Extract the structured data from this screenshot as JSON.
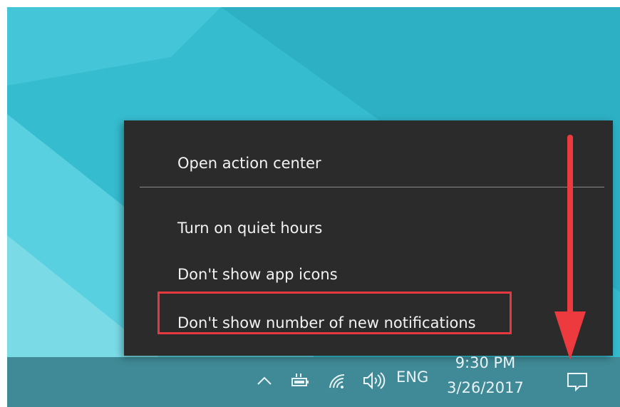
{
  "context_menu": {
    "items": [
      {
        "label": "Open action center"
      },
      {
        "label": "Turn on quiet hours"
      },
      {
        "label": "Don't show app icons"
      },
      {
        "label": "Don't show number of new notifications"
      }
    ],
    "highlighted_item_index": 3
  },
  "taskbar": {
    "tray_icons": [
      "chevron-up-icon",
      "battery-plug-icon",
      "wifi-icon",
      "speaker-icon"
    ],
    "language": "ENG",
    "clock": {
      "time": "9:30 PM",
      "date": "3/26/2017"
    },
    "action_center_icon": "speech-bubble-icon"
  },
  "colors": {
    "wallpaper_light": "#6fd9e6",
    "wallpaper_mid": "#3fc6d8",
    "wallpaper_dark": "#2aa9bd",
    "taskbar": "#3f8a96",
    "menu_background": "#2b2b2b",
    "menu_text": "#f2f2f2",
    "annotation_red": "#e5393f"
  }
}
